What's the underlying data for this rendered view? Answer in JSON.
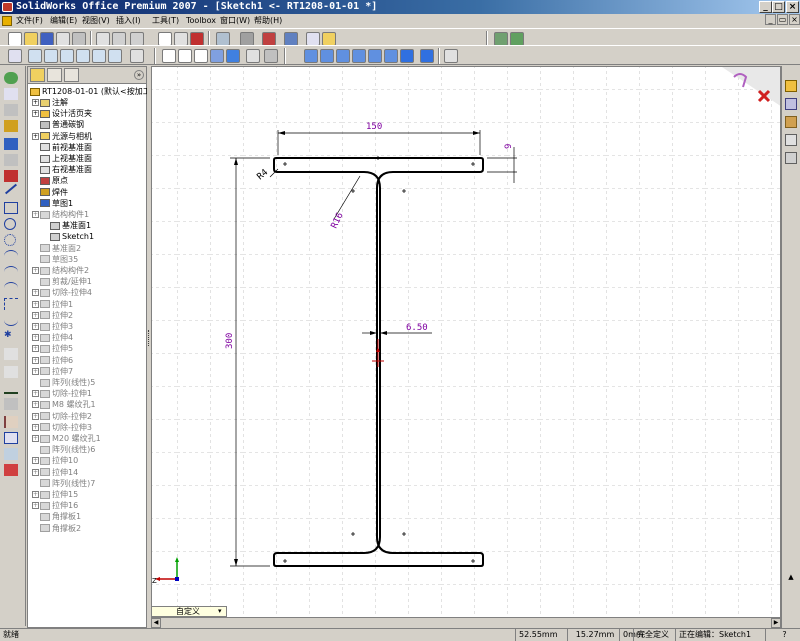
{
  "window": {
    "title": "SolidWorks Office Premium 2007 - [Sketch1 <- RT1208-01-01 *]",
    "minimize": "_",
    "maximize": "□",
    "close": "×"
  },
  "menu": {
    "items": [
      "文件(F)",
      "编辑(E)",
      "视图(V)",
      "插入(I)",
      "工具(T)",
      "Toolbox",
      "窗口(W)",
      "帮助(H)"
    ]
  },
  "tree": {
    "root": "RT1208-01-01",
    "root_config": "(默认<按加工>)",
    "items": [
      {
        "label": "注解",
        "state": "normal",
        "expand": true
      },
      {
        "label": "设计活页夹",
        "state": "normal",
        "expand": true
      },
      {
        "label": "普通碳钢",
        "state": "normal",
        "expand": false
      },
      {
        "label": "光源与相机",
        "state": "normal",
        "expand": true
      },
      {
        "label": "前视基准面",
        "state": "normal",
        "expand": false
      },
      {
        "label": "上视基准面",
        "state": "normal",
        "expand": false
      },
      {
        "label": "右视基准面",
        "state": "normal",
        "expand": false
      },
      {
        "label": "原点",
        "state": "normal",
        "expand": false
      },
      {
        "label": "焊件",
        "state": "normal",
        "expand": false
      },
      {
        "label": "草图1",
        "state": "normal",
        "expand": false
      },
      {
        "label": "结构构件1",
        "state": "gray",
        "expand": true
      },
      {
        "label": "基准面1",
        "state": "normal",
        "expand": false,
        "indent": 2
      },
      {
        "label": "Sketch1",
        "state": "normal",
        "expand": false,
        "indent": 2
      },
      {
        "label": "基准面2",
        "state": "gray",
        "expand": false
      },
      {
        "label": "草图35",
        "state": "gray",
        "expand": false
      },
      {
        "label": "结构构件2",
        "state": "gray",
        "expand": true
      },
      {
        "label": "剪裁/延伸1",
        "state": "gray",
        "expand": false
      },
      {
        "label": "切除-拉伸4",
        "state": "gray",
        "expand": true
      },
      {
        "label": "拉伸1",
        "state": "gray",
        "expand": true
      },
      {
        "label": "拉伸2",
        "state": "gray",
        "expand": true
      },
      {
        "label": "拉伸3",
        "state": "gray",
        "expand": true
      },
      {
        "label": "拉伸4",
        "state": "gray",
        "expand": true
      },
      {
        "label": "拉伸5",
        "state": "gray",
        "expand": true
      },
      {
        "label": "拉伸6",
        "state": "gray",
        "expand": true
      },
      {
        "label": "拉伸7",
        "state": "gray",
        "expand": true
      },
      {
        "label": "阵列(线性)5",
        "state": "gray",
        "expand": false
      },
      {
        "label": "切除-拉伸1",
        "state": "gray",
        "expand": true
      },
      {
        "label": "M8 螺纹孔1",
        "state": "gray",
        "expand": true
      },
      {
        "label": "切除-拉伸2",
        "state": "gray",
        "expand": true
      },
      {
        "label": "切除-拉伸3",
        "state": "gray",
        "expand": true
      },
      {
        "label": "M20 螺纹孔1",
        "state": "gray",
        "expand": true
      },
      {
        "label": "阵列(线性)6",
        "state": "gray",
        "expand": false
      },
      {
        "label": "拉伸10",
        "state": "gray",
        "expand": true
      },
      {
        "label": "拉伸14",
        "state": "gray",
        "expand": true
      },
      {
        "label": "阵列(线性)7",
        "state": "gray",
        "expand": false
      },
      {
        "label": "拉伸15",
        "state": "gray",
        "expand": true
      },
      {
        "label": "拉伸16",
        "state": "gray",
        "expand": true
      },
      {
        "label": "角撑板1",
        "state": "gray",
        "expand": false
      },
      {
        "label": "角撑板2",
        "state": "gray",
        "expand": false
      }
    ]
  },
  "sketch": {
    "dim_width": "150",
    "dim_height": "300",
    "dim_web": "6.50",
    "dim_flange": "9",
    "dim_r4": "R4",
    "dim_r16": "R16"
  },
  "canvas": {
    "view_dropdown": "自定义"
  },
  "status": {
    "left": "就绪",
    "x": "52.55mm",
    "y": "15.27mm",
    "z": "0mm",
    "def": "完全定义",
    "mode": "正在编辑：Sketch1",
    "help": "?"
  },
  "colors": {
    "sketch_line": "#000000",
    "dimension": "#7f00a0",
    "grid": "#b8b8b8",
    "selection_green": "#00a000"
  }
}
